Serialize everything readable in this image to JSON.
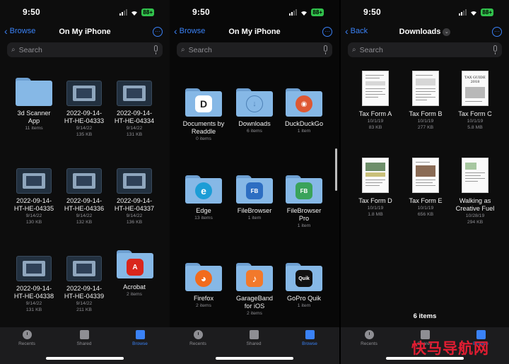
{
  "colors": {
    "accent": "#3a82f7",
    "folder": "#86b8e6",
    "battery": "#31c24c",
    "watermark": "#e21d32"
  },
  "status": {
    "time": "9:50",
    "battery": "88+"
  },
  "panel1": {
    "back_label": "Browse",
    "title": "On My iPhone",
    "search_placeholder": "Search",
    "items": [
      {
        "name1": "3d Scanner",
        "name2": "App",
        "meta1": "11 items",
        "meta2": "",
        "kind": "folder"
      },
      {
        "name1": "2022-09-14-",
        "name2": "HT-HE-04333",
        "meta1": "9/14/22",
        "meta2": "135 KB",
        "kind": "image"
      },
      {
        "name1": "2022-09-14-",
        "name2": "HT-HE-04334",
        "meta1": "9/14/22",
        "meta2": "131 KB",
        "kind": "image"
      },
      {
        "name1": "2022-09-14-",
        "name2": "HT-HE-04335",
        "meta1": "9/14/22",
        "meta2": "130 KB",
        "kind": "image"
      },
      {
        "name1": "2022-09-14-",
        "name2": "HT-HE-04336",
        "meta1": "9/14/22",
        "meta2": "132 KB",
        "kind": "image"
      },
      {
        "name1": "2022-09-14-",
        "name2": "HT-HE-04337",
        "meta1": "9/14/22",
        "meta2": "136 KB",
        "kind": "image"
      },
      {
        "name1": "2022-09-14-",
        "name2": "HT-HE-04338",
        "meta1": "9/14/22",
        "meta2": "131 KB",
        "kind": "image"
      },
      {
        "name1": "2022-09-14-",
        "name2": "HT-HE-04339",
        "meta1": "9/14/22",
        "meta2": "211 KB",
        "kind": "image"
      },
      {
        "name1": "Acrobat",
        "name2": "",
        "meta1": "2 items",
        "meta2": "",
        "kind": "acrobat"
      }
    ]
  },
  "panel2": {
    "back_label": "Browse",
    "title": "On My iPhone",
    "search_placeholder": "Search",
    "items": [
      {
        "name1": "Documents by",
        "name2": "Readdle",
        "meta": "0 items",
        "icon": "D",
        "icon_name": "readdle-icon"
      },
      {
        "name1": "Downloads",
        "name2": "",
        "meta": "6 items",
        "icon": "↓",
        "icon_name": "download-icon"
      },
      {
        "name1": "DuckDuckGo",
        "name2": "",
        "meta": "1 item",
        "icon": "◉",
        "icon_name": "duckduckgo-icon"
      },
      {
        "name1": "Edge",
        "name2": "",
        "meta": "13 items",
        "icon": "e",
        "icon_name": "edge-icon"
      },
      {
        "name1": "FileBrowser",
        "name2": "",
        "meta": "1 item",
        "icon": "FB",
        "icon_name": "filebrowser-icon"
      },
      {
        "name1": "FileBrowser",
        "name2": "Pro",
        "meta": "1 item",
        "icon": "FB",
        "icon_name": "filebrowser-pro-icon"
      },
      {
        "name1": "Firefox",
        "name2": "",
        "meta": "2 items",
        "icon": "◕",
        "icon_name": "firefox-icon"
      },
      {
        "name1": "GarageBand",
        "name2": "for iOS",
        "meta": "2 items",
        "icon": "♪",
        "icon_name": "garageband-icon"
      },
      {
        "name1": "GoPro Quik",
        "name2": "",
        "meta": "1 item",
        "icon": "Quik",
        "icon_name": "gopro-quik-icon"
      }
    ]
  },
  "panel3": {
    "back_label": "Back",
    "title": "Downloads",
    "search_placeholder": "Search",
    "count": "6 items",
    "items": [
      {
        "name1": "Tax Form A",
        "name2": "",
        "date": "10/1/19",
        "size": "83 KB"
      },
      {
        "name1": "Tax Form B",
        "name2": "",
        "date": "10/1/19",
        "size": "277 KB"
      },
      {
        "name1": "Tax Form C",
        "name2": "",
        "date": "10/1/19",
        "size": "5.8 MB"
      },
      {
        "name1": "Tax Form D",
        "name2": "",
        "date": "10/1/19",
        "size": "1.8 MB"
      },
      {
        "name1": "Tax Form E",
        "name2": "",
        "date": "10/1/19",
        "size": "656 KB"
      },
      {
        "name1": "Walking as",
        "name2": "Creative Fuel",
        "date": "10/28/19",
        "size": "294 KB"
      }
    ]
  },
  "tabs": {
    "recents": "Recents",
    "shared": "Shared",
    "browse": "Browse"
  },
  "watermark": "快马导航网",
  "doc_c_heading": "TAX GUIDE 2018"
}
